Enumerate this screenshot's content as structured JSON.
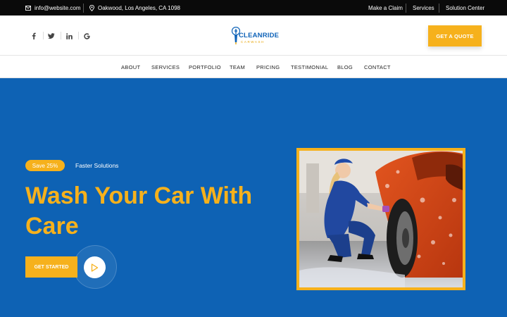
{
  "topbar": {
    "email": "info@website.com",
    "address": "Oakwood, Los Angeles, CA 1098",
    "links": [
      "Make a Claim",
      "Services",
      "Solution Center"
    ]
  },
  "header": {
    "social": [
      "facebook-icon",
      "twitter-icon",
      "linkedin-icon",
      "google-icon"
    ],
    "logo_text": "CLEANRIDE",
    "logo_sub": "CARWASH",
    "quote_button": "GET A QUOTE"
  },
  "nav": {
    "items": [
      "ABOUT",
      "SERVICES",
      "PORTFOLIO",
      "TEAM",
      "PRICING",
      "TESTIMONIAL",
      "BLOG",
      "CONTACT"
    ]
  },
  "hero": {
    "badge": "Save 25%",
    "tagline": "Faster Solutions",
    "headline_line1": "Wash Your Car With",
    "headline_line2": "Care",
    "cta": "GET STARTED"
  },
  "colors": {
    "accent": "#f6b11c",
    "hero_bg": "#0e62b4",
    "brand_blue": "#0f63b8",
    "topbar_bg": "#0a0a0a"
  }
}
